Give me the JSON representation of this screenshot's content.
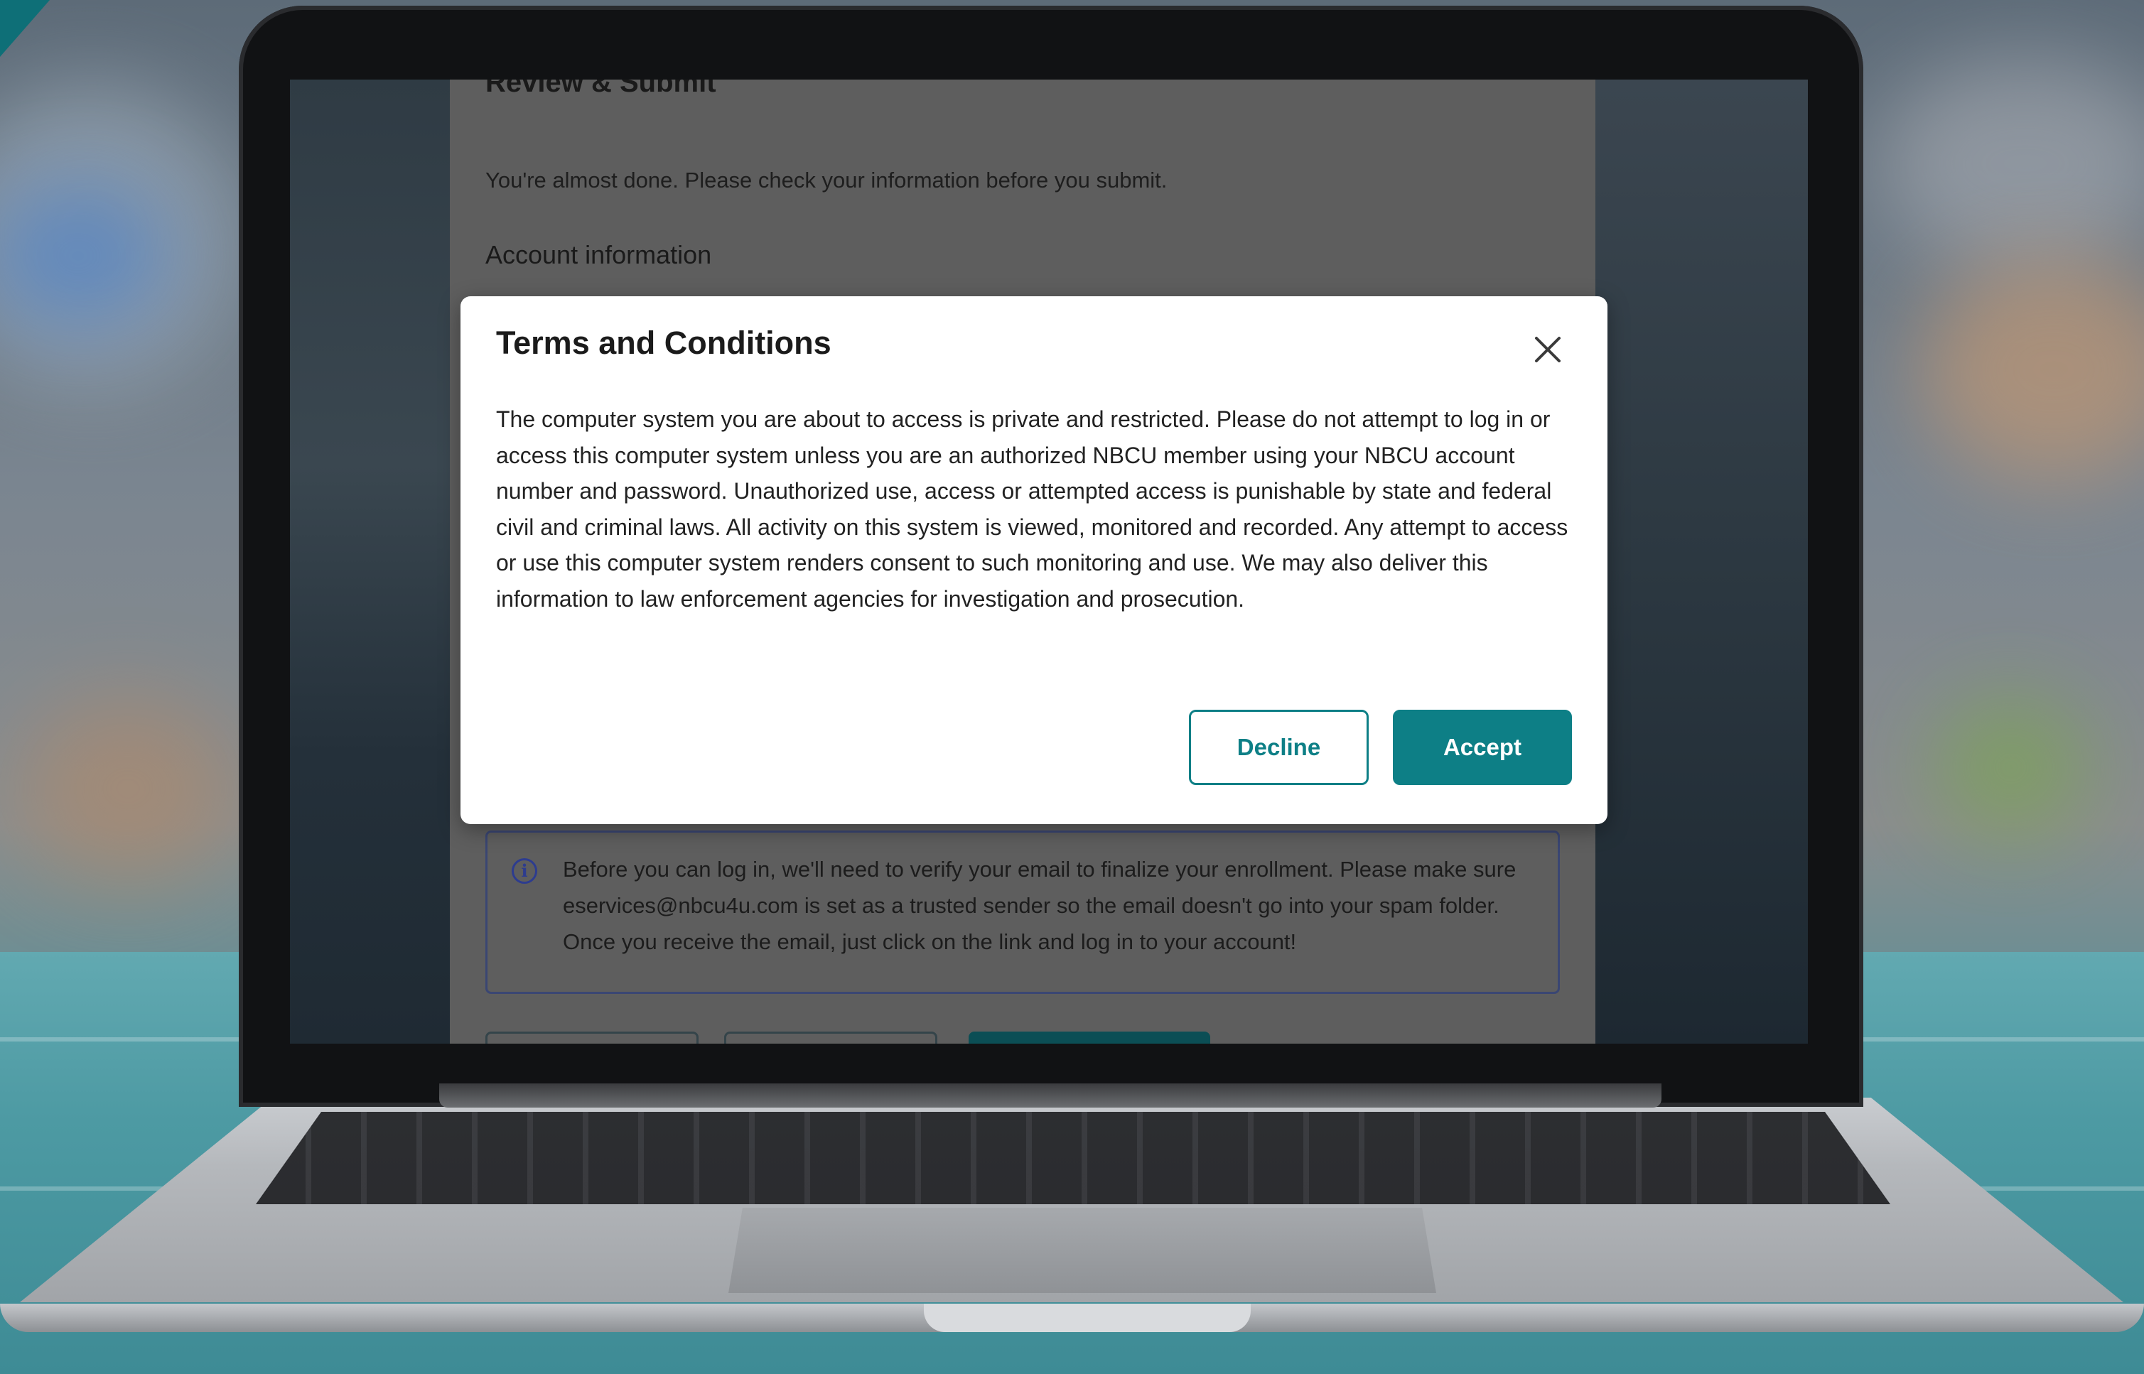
{
  "background_page": {
    "heading": "Review & Submit",
    "intro": "You're almost done. Please check your information before you submit.",
    "section_title": "Account information",
    "info_notice": "Before you can log in, we'll need to verify your email to finalize your enrollment. Please make sure eservices@nbcu4u.com is set as a trusted sender so the email doesn't go into your spam folder. Once you receive the email, just click on the link and log in to your account!"
  },
  "modal": {
    "title": "Terms and Conditions",
    "close_icon": "close-icon",
    "body": "The computer system you are about to access is private and restricted. Please do not attempt to log in or access this computer system unless you are an authorized NBCU member using your NBCU account number and password. Unauthorized use, access or attempted access is punishable by state and federal civil and criminal laws. All activity on this system is viewed, monitored and recorded. Any attempt to access or use this computer system renders consent to such monitoring and use. We may also deliver this information to law enforcement agencies for investigation and prosecution.",
    "decline_label": "Decline",
    "accept_label": "Accept"
  },
  "colors": {
    "accent": "#0d7f86",
    "overlay_page": "#5e5e5e",
    "info_border": "#3a4673"
  }
}
